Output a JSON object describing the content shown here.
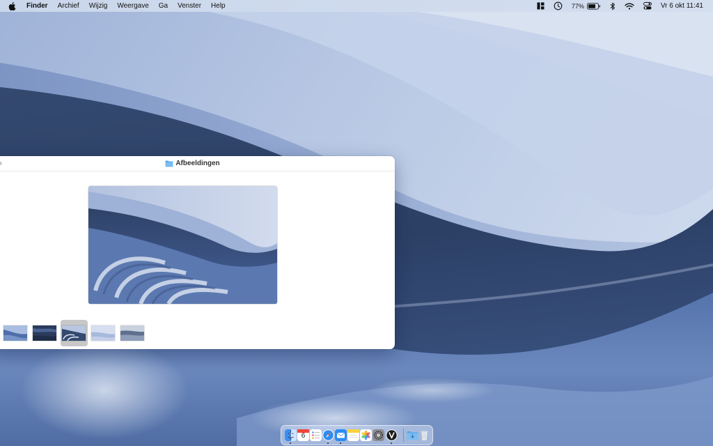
{
  "menubar": {
    "app_name": "Finder",
    "items": [
      "Archief",
      "Wijzig",
      "Weergave",
      "Ga",
      "Venster",
      "Help"
    ],
    "battery_percent": "77%",
    "battery_level": 0.77,
    "datetime": "Vr 6 okt  11:41"
  },
  "window": {
    "title": "Afbeeldingen",
    "selected_thumbnail_index": 2
  },
  "dock": {
    "calendar_day": "6",
    "apps": [
      "finder",
      "calendar",
      "reminders",
      "safari",
      "mail",
      "notes",
      "photos",
      "system-settings",
      "vectorworks",
      "downloads-folder",
      "trash"
    ]
  },
  "colors": {
    "accent": "#3a82f7",
    "wallpaper_dark": "#2d4266",
    "wallpaper_light": "#d2dcee"
  }
}
